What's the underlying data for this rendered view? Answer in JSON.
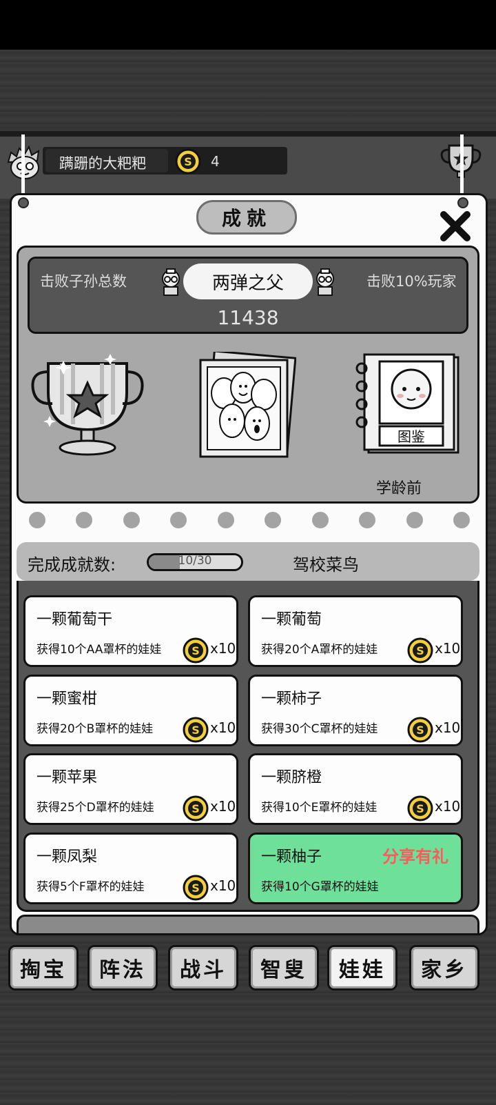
{
  "header": {
    "player_name": "蹒跚的大粑粑",
    "coins": "4"
  },
  "panel": {
    "title": "成就",
    "defeat_label": "击败子孙总数",
    "rank_title": "两弹之父",
    "defeat_percent": "击败10%玩家",
    "defeat_count": "11438",
    "handbook_label": "学龄前",
    "handbook_cover": "图鉴",
    "page_dots": 10
  },
  "progress": {
    "label": "完成成就数:",
    "text": "10/30",
    "value": 0.3333,
    "rank": "驾校菜鸟"
  },
  "achievements": [
    {
      "title": "一颗葡萄干",
      "desc": "获得10个AA罩杯的娃娃",
      "reward": "x10"
    },
    {
      "title": "一颗葡萄",
      "desc": "获得20个A罩杯的娃娃",
      "reward": "x10"
    },
    {
      "title": "一颗蜜柑",
      "desc": "获得20个B罩杯的娃娃",
      "reward": "x10"
    },
    {
      "title": "一颗柿子",
      "desc": "获得30个C罩杯的娃娃",
      "reward": "x10"
    },
    {
      "title": "一颗苹果",
      "desc": "获得25个D罩杯的娃娃",
      "reward": "x10"
    },
    {
      "title": "一颗脐橙",
      "desc": "获得10个E罩杯的娃娃",
      "reward": "x10"
    },
    {
      "title": "一颗凤梨",
      "desc": "获得5个F罩杯的娃娃",
      "reward": "x10"
    },
    {
      "title": "一颗柚子",
      "desc": "获得10个G罩杯的娃娃",
      "share": "分享有礼"
    }
  ],
  "nav": [
    "掏宝",
    "阵法",
    "战斗",
    "智叟",
    "娃娃",
    "家乡"
  ],
  "nav_active": "娃娃",
  "colors": {
    "share_card": "#6ee09a",
    "share_text": "#ff5a5a",
    "coin": "#f2cf3c"
  }
}
